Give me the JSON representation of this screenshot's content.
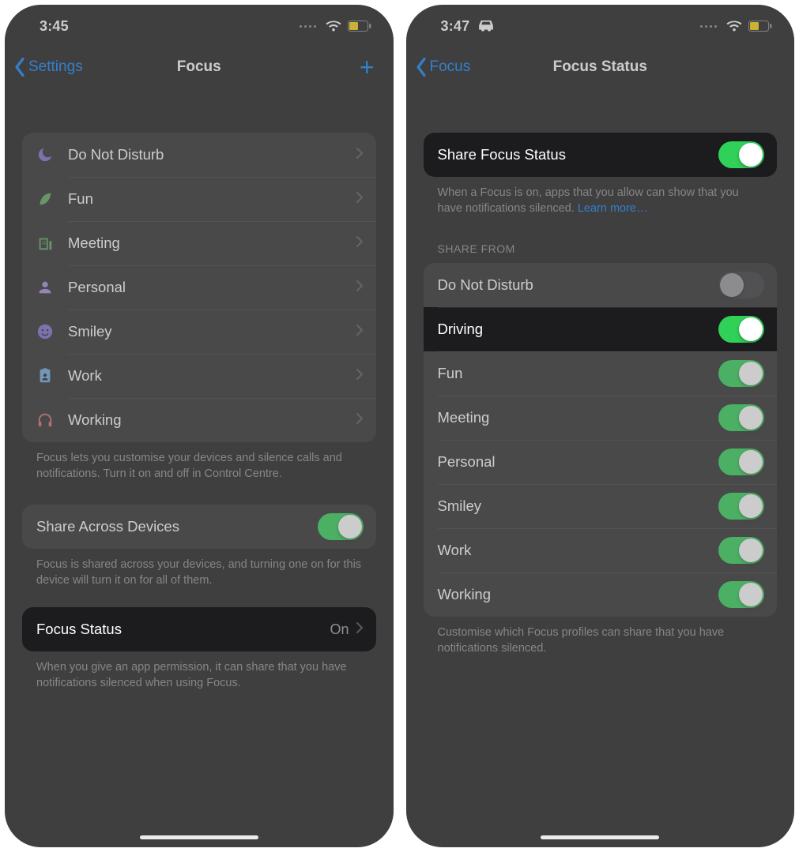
{
  "left": {
    "status": {
      "time": "3:45"
    },
    "nav": {
      "back": "Settings",
      "title": "Focus"
    },
    "modes": [
      {
        "label": "Do Not Disturb"
      },
      {
        "label": "Fun"
      },
      {
        "label": "Meeting"
      },
      {
        "label": "Personal"
      },
      {
        "label": "Smiley"
      },
      {
        "label": "Work"
      },
      {
        "label": "Working"
      }
    ],
    "modes_footer": "Focus lets you customise your devices and silence calls and notifications. Turn it on and off in Control Centre.",
    "share_across": {
      "label": "Share Across Devices",
      "on": true
    },
    "share_across_footer": "Focus is shared across your devices, and turning one on for this device will turn it on for all of them.",
    "focus_status": {
      "label": "Focus Status",
      "value": "On"
    },
    "focus_status_footer": "When you give an app permission, it can share that you have notifications silenced when using Focus."
  },
  "right": {
    "status": {
      "time": "3:47"
    },
    "nav": {
      "back": "Focus",
      "title": "Focus Status"
    },
    "share_row": {
      "label": "Share Focus Status",
      "on": true
    },
    "share_footer": "When a Focus is on, apps that you allow can show that you have notifications silenced. ",
    "learn_more": "Learn more…",
    "section_header": "Share From",
    "items": [
      {
        "label": "Do Not Disturb",
        "on": false,
        "highlight": false
      },
      {
        "label": "Driving",
        "on": true,
        "highlight": true
      },
      {
        "label": "Fun",
        "on": true,
        "highlight": false
      },
      {
        "label": "Meeting",
        "on": true,
        "highlight": false
      },
      {
        "label": "Personal",
        "on": true,
        "highlight": false
      },
      {
        "label": "Smiley",
        "on": true,
        "highlight": false
      },
      {
        "label": "Work",
        "on": true,
        "highlight": false
      },
      {
        "label": "Working",
        "on": true,
        "highlight": false
      }
    ],
    "items_footer": "Customise which Focus profiles can share that you have notifications silenced."
  }
}
